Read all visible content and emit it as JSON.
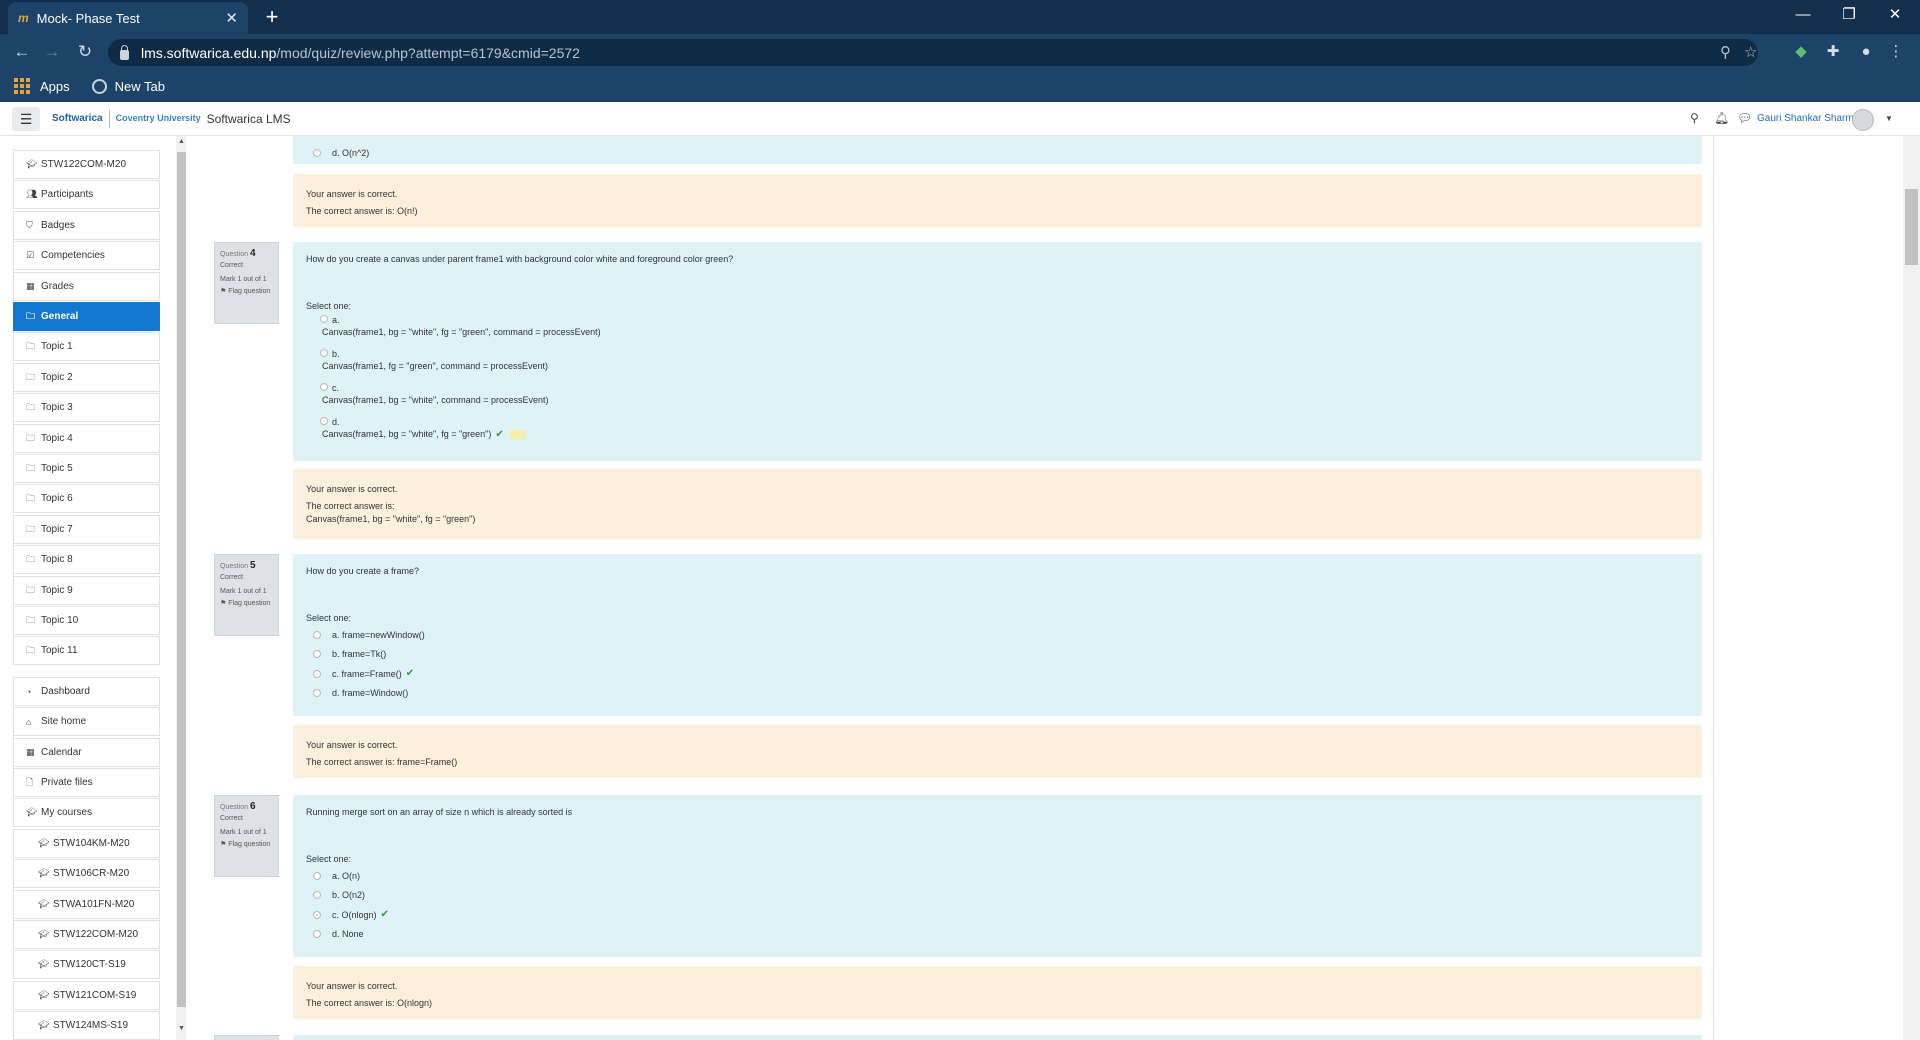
{
  "browser": {
    "tab_title": "Mock- Phase Test",
    "tab_favicon": "m",
    "url_host": "lms.softwarica.edu.np",
    "url_path": "/mod/quiz/review.php?attempt=6179&cmid=2572",
    "bookmarks": [
      "Apps",
      "New Tab"
    ]
  },
  "header": {
    "site_name": "Softwarica LMS",
    "logo_text": "Softwarica",
    "logo_partner": "Coventry University",
    "user_name": "Gauri Shankar Sharma"
  },
  "sidebar": {
    "course_items": [
      {
        "label": "STW122COM-M20",
        "icon": "mortarboard-icon"
      },
      {
        "label": "Participants",
        "icon": "users-icon"
      },
      {
        "label": "Badges",
        "icon": "shield-icon"
      },
      {
        "label": "Competencies",
        "icon": "checkbox-icon"
      },
      {
        "label": "Grades",
        "icon": "table-icon"
      },
      {
        "label": "General",
        "icon": "folder-icon",
        "active": true
      },
      {
        "label": "Topic 1",
        "icon": "folder-icon"
      },
      {
        "label": "Topic 2",
        "icon": "folder-icon"
      },
      {
        "label": "Topic 3",
        "icon": "folder-icon"
      },
      {
        "label": "Topic 4",
        "icon": "folder-icon"
      },
      {
        "label": "Topic 5",
        "icon": "folder-icon"
      },
      {
        "label": "Topic 6",
        "icon": "folder-icon"
      },
      {
        "label": "Topic 7",
        "icon": "folder-icon"
      },
      {
        "label": "Topic 8",
        "icon": "folder-icon"
      },
      {
        "label": "Topic 9",
        "icon": "folder-icon"
      },
      {
        "label": "Topic 10",
        "icon": "folder-icon"
      },
      {
        "label": "Topic 11",
        "icon": "folder-icon"
      }
    ],
    "site_items": [
      {
        "label": "Dashboard",
        "icon": "dashboard-icon"
      },
      {
        "label": "Site home",
        "icon": "home-icon"
      },
      {
        "label": "Calendar",
        "icon": "calendar-icon"
      },
      {
        "label": "Private files",
        "icon": "file-icon"
      },
      {
        "label": "My courses",
        "icon": "mortarboard-icon"
      }
    ],
    "my_courses": [
      "STW104KM-M20",
      "STW106CR-M20",
      "STWA101FN-M20",
      "STW122COM-M20",
      "STW120CT-S19",
      "STW121COM-S19",
      "STW124MS-S19"
    ]
  },
  "quiz": {
    "prev_tail": {
      "last_option": "d. O(n^2)",
      "feedback_correct": "Your answer is correct.",
      "feedback_answer": "The correct answer is: O(n!)"
    },
    "labels": {
      "question": "Question",
      "select_one": "Select one:",
      "flag": "Flag question"
    },
    "questions": [
      {
        "number": "4",
        "status": "Correct",
        "mark": "Mark 1 out of 1",
        "text": "How do you create a canvas under parent frame1 with background color white and foreground color green?",
        "options": [
          {
            "letter": "a.",
            "text": "Canvas(frame1, bg = \"white\", fg = \"green\", command = processEvent)",
            "selected": false
          },
          {
            "letter": "b.",
            "text": "Canvas(frame1, fg = \"green\", command = processEvent)",
            "selected": false
          },
          {
            "letter": "c.",
            "text": "Canvas(frame1, bg = \"white\", command = processEvent)",
            "selected": false
          },
          {
            "letter": "d.",
            "text": "Canvas(frame1, bg = \"white\", fg = \"green\")",
            "selected": true
          }
        ],
        "feedback": {
          "correct": "Your answer is correct.",
          "answer_label": "The correct answer is:",
          "answer": "Canvas(frame1, bg = \"white\", fg = \"green\")"
        }
      },
      {
        "number": "5",
        "status": "Correct",
        "mark": "Mark 1 out of 1",
        "text": "How do you create a frame?",
        "options": [
          {
            "text": "a. frame=newWindow()",
            "selected": false
          },
          {
            "text": "b. frame=Tk()",
            "selected": false
          },
          {
            "text": "c. frame=Frame()",
            "selected": true
          },
          {
            "text": "d. frame=Window()",
            "selected": false
          }
        ],
        "feedback": {
          "correct": "Your answer is correct.",
          "answer": "The correct answer is: frame=Frame()"
        }
      },
      {
        "number": "6",
        "status": "Correct",
        "mark": "Mark 1 out of 1",
        "text": "Running merge sort on an array of size n which is already sorted is",
        "options": [
          {
            "text": "a. O(n)",
            "selected": false
          },
          {
            "text": "b. O(n2)",
            "selected": false
          },
          {
            "text": "c. O(nlogn)",
            "selected": true
          },
          {
            "text": "d. None",
            "selected": false
          }
        ],
        "feedback": {
          "correct": "Your answer is correct.",
          "answer": "The correct answer is: O(nlogn)"
        }
      }
    ]
  },
  "colors": {
    "chrome_tabstrip": "#142f4d",
    "chrome_toolbar": "#1e4369",
    "nav_active": "#1177d1",
    "question_bg": "#def2f8",
    "feedback_bg": "#fcefdc",
    "tick": "#2e9e3b"
  }
}
